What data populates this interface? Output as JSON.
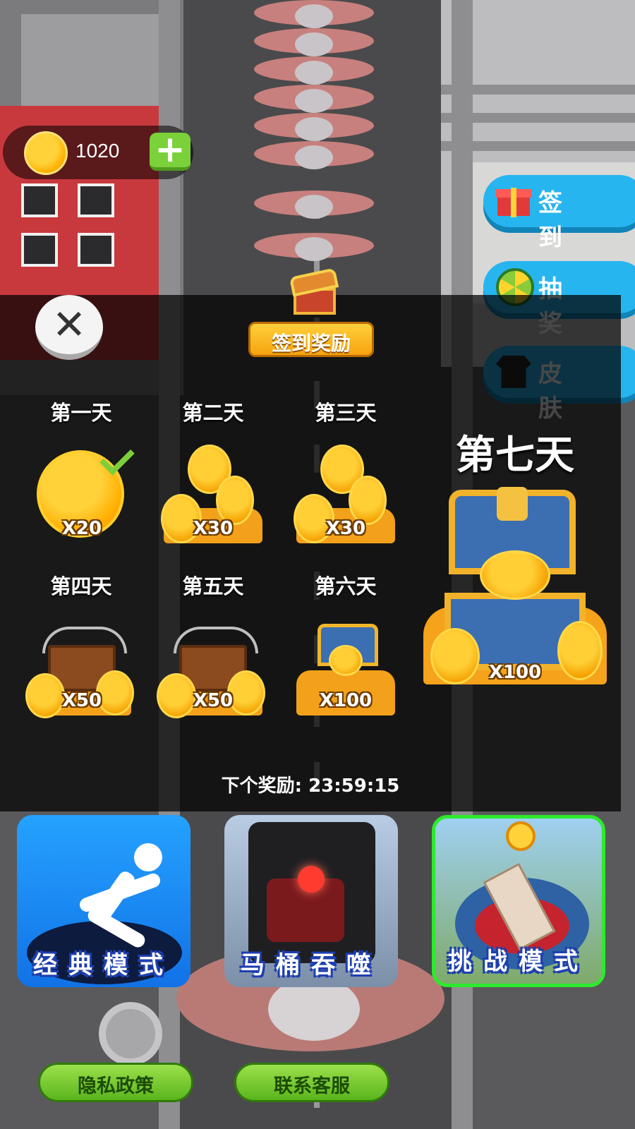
{
  "wallet": {
    "coins": "1020",
    "add_label": "+"
  },
  "side_menu": {
    "signin_label": "签 到",
    "lottery_label": "抽 奖",
    "skin_label": "皮 肤"
  },
  "signin_panel": {
    "title": "签到奖励",
    "close_label": "✕",
    "days": [
      {
        "label": "第一天",
        "amount": "X20",
        "claimed": true
      },
      {
        "label": "第二天",
        "amount": "X30",
        "claimed": false
      },
      {
        "label": "第三天",
        "amount": "X30",
        "claimed": false
      },
      {
        "label": "第四天",
        "amount": "X50",
        "claimed": false
      },
      {
        "label": "第五天",
        "amount": "X50",
        "claimed": false
      },
      {
        "label": "第六天",
        "amount": "X100",
        "claimed": false
      },
      {
        "label": "第七天",
        "amount": "X100",
        "claimed": false
      }
    ],
    "next_reward_label": "下个奖励:",
    "next_reward_time": "23:59:15"
  },
  "modes": [
    {
      "label": "经典模式",
      "selected": false
    },
    {
      "label": "马桶吞噬",
      "selected": false
    },
    {
      "label": "挑战模式",
      "selected": true
    }
  ],
  "footer": {
    "privacy_label": "隐私政策",
    "support_label": "联系客服"
  },
  "colors": {
    "side_button": "#27b5ef",
    "coin": "#ffb000",
    "selected_border": "#2dea2d",
    "footer_button": "#7bd13a"
  }
}
